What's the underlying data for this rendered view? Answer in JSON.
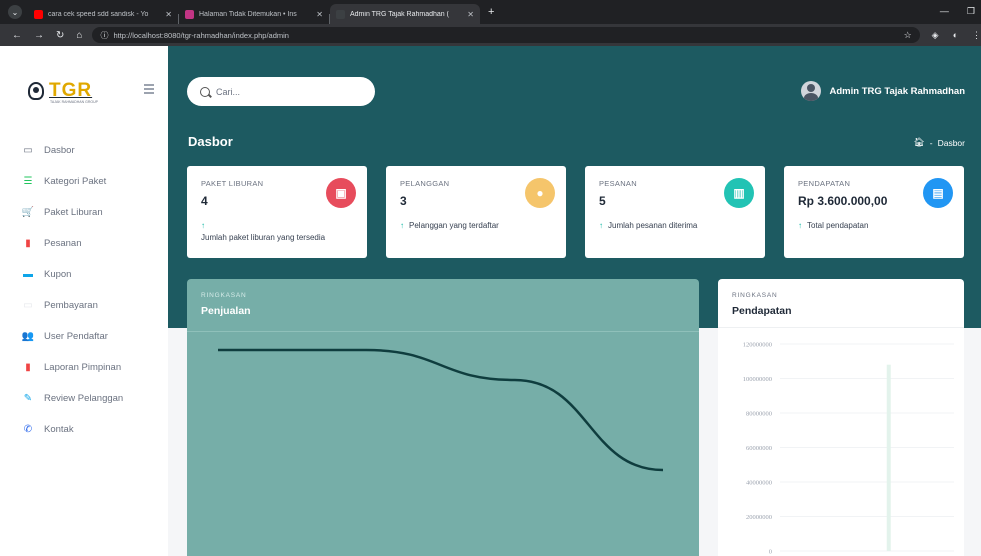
{
  "browser": {
    "tabs": [
      {
        "title": "cara cek speed sdd sandisk - Yo",
        "favicon_color": "#ff0000"
      },
      {
        "title": "Halaman Tidak Ditemukan • Ins",
        "favicon_color": "#c13584"
      },
      {
        "title": "Admin TRG Tajak Rahmadhan (",
        "favicon_color": "#3c4043"
      }
    ],
    "new_tab": "+",
    "url": "http://localhost:8080/tgr-rahmadhan/index.php/admin"
  },
  "sidebar": {
    "logo": "TGR",
    "logo_tagline": "TAJAK RAHMADHAN GROUP",
    "items": [
      {
        "label": "Dasbor",
        "icon": "monitor-icon",
        "glyph": "▭",
        "color": "#6b7280"
      },
      {
        "label": "Kategori Paket",
        "icon": "list-icon",
        "glyph": "☰",
        "color": "#22c55e"
      },
      {
        "label": "Paket Liburan",
        "icon": "cart-icon",
        "glyph": "🛒",
        "color": "#14b8a6"
      },
      {
        "label": "Pesanan",
        "icon": "order-icon",
        "glyph": "▮",
        "color": "#ef4444"
      },
      {
        "label": "Kupon",
        "icon": "ticket-icon",
        "glyph": "▬",
        "color": "#0ea5e9"
      },
      {
        "label": "Pembayaran",
        "icon": "payment-icon",
        "glyph": "▭",
        "color": "#e5e7eb"
      },
      {
        "label": "User Pendaftar",
        "icon": "users-icon",
        "glyph": "👥",
        "color": "#374151"
      },
      {
        "label": "Laporan Pimpinan",
        "icon": "report-icon",
        "glyph": "▮",
        "color": "#ef4444"
      },
      {
        "label": "Review Pelanggan",
        "icon": "edit-icon",
        "glyph": "✎",
        "color": "#0ea5e9"
      },
      {
        "label": "Kontak",
        "icon": "phone-icon",
        "glyph": "✆",
        "color": "#2563eb"
      }
    ]
  },
  "header": {
    "search_placeholder": "Cari...",
    "user_name": "Admin TRG Tajak Rahmadhan",
    "page_title": "Dasbor",
    "breadcrumb": "Dasbor"
  },
  "cards": [
    {
      "label": "PAKET LIBURAN",
      "value": "4",
      "note": "Jumlah paket liburan yang tersedia",
      "icon": "bag-icon",
      "icon_bg": "#e74c5c"
    },
    {
      "label": "PELANGGAN",
      "value": "3",
      "note": "Pelanggan yang terdaftar",
      "icon": "user-icon",
      "icon_bg": "#f5c56b"
    },
    {
      "label": "PESANAN",
      "value": "5",
      "note": "Jumlah pesanan diterima",
      "icon": "bar-chart-icon",
      "icon_bg": "#22c3b4"
    },
    {
      "label": "PENDAPATAN",
      "value": "Rp 3.600.000,00",
      "note": "Total pendapatan",
      "icon": "money-icon",
      "icon_bg": "#2196f3"
    }
  ],
  "sales_panel": {
    "kicker": "RINGKASAN",
    "title": "Penjualan"
  },
  "income_panel": {
    "kicker": "RINGKASAN",
    "title": "Pendapatan"
  },
  "chart_data": [
    {
      "type": "line",
      "x": [
        0,
        1,
        2,
        3
      ],
      "series": [
        {
          "values": [
            1,
            1,
            0.85,
            0.4
          ]
        }
      ],
      "title": "",
      "xlabel": "",
      "ylabel": "",
      "grid": false
    },
    {
      "type": "bar",
      "categories": [
        "",
        "",
        "",
        ""
      ],
      "values": [
        0,
        0,
        108000000,
        0
      ],
      "ylim": [
        0,
        120000000
      ],
      "y_ticks": [
        "0",
        "20000000",
        "40000000",
        "60000000",
        "80000000",
        "100000000",
        "120000000"
      ],
      "grid": true
    }
  ]
}
